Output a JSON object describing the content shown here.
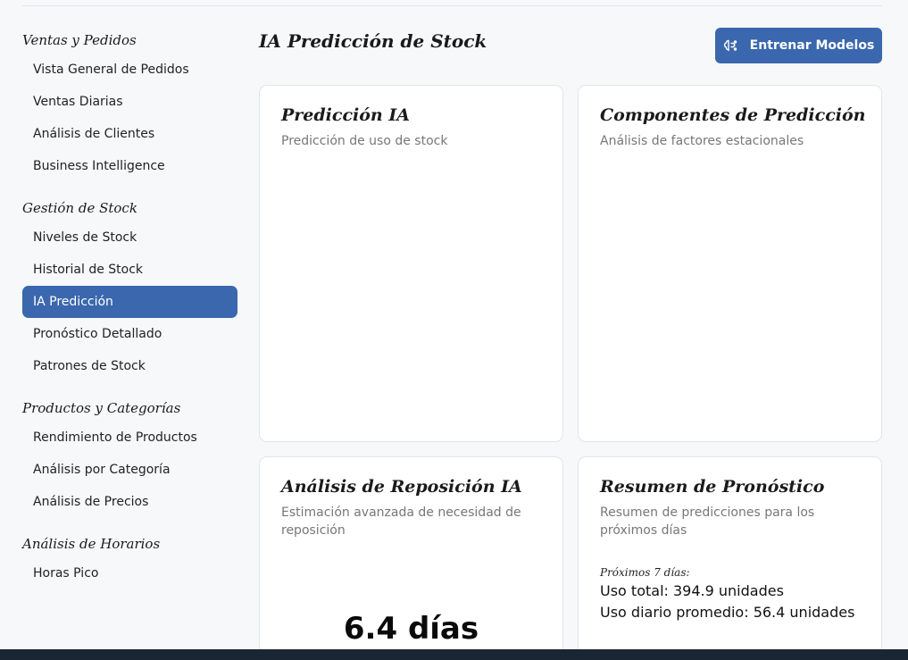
{
  "sidebar": {
    "sections": [
      {
        "title": "Ventas y Pedidos",
        "items": [
          "Vista General de Pedidos",
          "Ventas Diarias",
          "Análisis de Clientes",
          "Business Intelligence"
        ]
      },
      {
        "title": "Gestión de Stock",
        "items": [
          "Niveles de Stock",
          "Historial de Stock",
          "IA Predicción",
          "Pronóstico Detallado",
          "Patrones de Stock"
        ]
      },
      {
        "title": "Productos y Categorías",
        "items": [
          "Rendimiento de Productos",
          "Análisis por Categoría",
          "Análisis de Precios"
        ]
      },
      {
        "title": "Análisis de Horarios",
        "items": [
          "Horas Pico"
        ]
      }
    ],
    "active_item": "IA Predicción"
  },
  "header": {
    "title": "IA Predicción de Stock",
    "train_button_label": "Entrenar Modelos",
    "train_button_icon": "brain-icon"
  },
  "cards": {
    "prediction": {
      "title": "Predicción IA",
      "subtitle": "Predicción de uso de stock"
    },
    "components": {
      "title": "Componentes de Predicción",
      "subtitle": "Análisis de factores estacionales"
    },
    "replenishment": {
      "title": "Análisis de Reposición IA",
      "subtitle": "Estimación avanzada de necesidad de reposición",
      "value": "6.4 días"
    },
    "summary": {
      "title": "Resumen de Pronóstico",
      "subtitle": "Resumen de predicciones para los próximos días",
      "next_label": "Próximos 7 días:",
      "total_usage": "Uso total: 394.9 unidades",
      "daily_avg": "Uso diario promedio: 56.4 unidades"
    }
  },
  "colors": {
    "accent": "#3a67ad",
    "background": "#f7f8fa",
    "card": "#ffffff"
  }
}
